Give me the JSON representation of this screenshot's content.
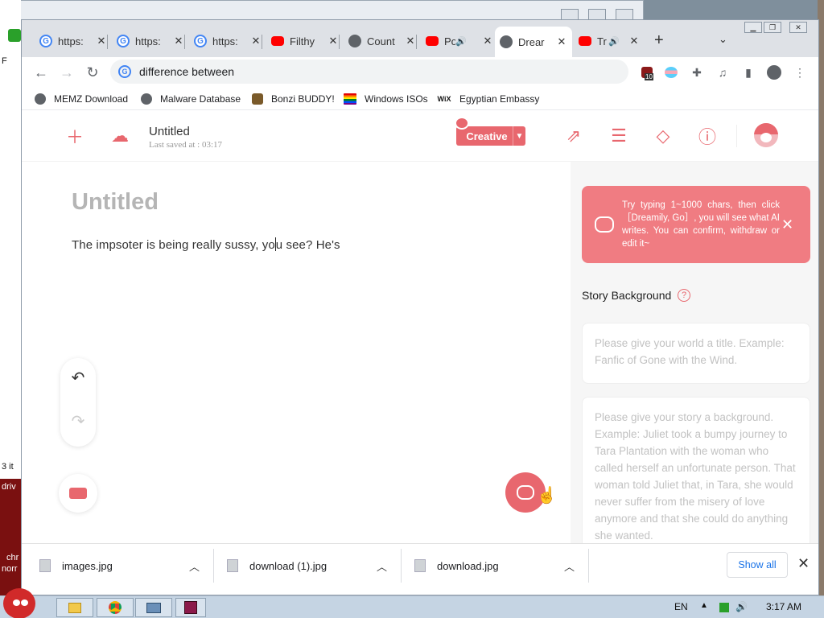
{
  "desktop": {
    "left_strip_texts": [
      "F",
      "3 it",
      "driv",
      "chr",
      "norr"
    ]
  },
  "tabs": [
    {
      "title": "https:",
      "icon": "google-icon"
    },
    {
      "title": "https:",
      "icon": "google-icon"
    },
    {
      "title": "https:",
      "icon": "google-icon"
    },
    {
      "title": "Filthy",
      "icon": "youtube-icon"
    },
    {
      "title": "Count",
      "icon": "globe-icon"
    },
    {
      "title": "Po",
      "icon": "youtube-icon"
    },
    {
      "title": "Drear",
      "icon": "globe-icon"
    },
    {
      "title": "Tr",
      "icon": "youtube-icon"
    }
  ],
  "address_bar": {
    "value": "difference between"
  },
  "extension_badge": "10",
  "bookmarks": [
    {
      "label": "MEMZ Download"
    },
    {
      "label": "Malware Database"
    },
    {
      "label": "Bonzi BUDDY!"
    },
    {
      "label": "Windows ISOs"
    },
    {
      "label": "Egyptian Embassy"
    }
  ],
  "app": {
    "header": {
      "doc_title": "Untitled",
      "last_saved": "Last saved at : 03:17",
      "mode_label": "Creative"
    },
    "editor": {
      "title": "Untitled",
      "body_before": "The impsoter is being really sussy, yo",
      "body_after": "u see? He's"
    },
    "panel": {
      "tip": "Try typing 1~1000 chars, then click［Dreamily, Go］, you will see what AI writes. You can confirm, withdraw or edit it~",
      "story_background_label": "Story Background",
      "title_placeholder": "Please give your world a title. Example: Fanfic of Gone with the Wind.",
      "background_placeholder": "Please give your story a background. Example: Juliet took a bumpy journey to Tara Plantation with the woman who called herself an unfortunate person. That woman told Juliet that, in Tara, she would never suffer from the misery of love anymore and that she could do anything she wanted."
    }
  },
  "downloads": [
    {
      "name": "images.jpg"
    },
    {
      "name": "download (1).jpg"
    },
    {
      "name": "download.jpg"
    }
  ],
  "downloads_show_all": "Show all",
  "taskbar": {
    "language": "EN",
    "clock": "3:17 AM"
  },
  "colors": {
    "brand": "#e8676e",
    "tip_bg": "#f07c82",
    "link_blue": "#1a73e8"
  }
}
